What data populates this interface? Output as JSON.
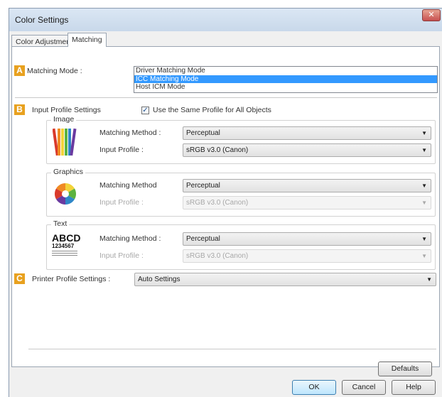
{
  "window": {
    "title": "Color Settings",
    "close_label": "✕"
  },
  "tabs": [
    {
      "label": "Color Adjustment"
    },
    {
      "label": "Matching"
    }
  ],
  "badges": {
    "a": "A",
    "b": "B",
    "c": "C"
  },
  "matching_mode": {
    "label": "Matching Mode :",
    "options": [
      "Driver Matching Mode",
      "ICC Matching Mode",
      "Host ICM Mode"
    ],
    "selected": "ICC Matching Mode"
  },
  "input_profile": {
    "label": "Input Profile Settings",
    "same_profile_label": "Use the Same Profile for All Objects",
    "same_profile_checked": true
  },
  "image_group": {
    "title": "Image",
    "method_label": "Matching Method :",
    "method_value": "Perceptual",
    "profile_label": "Input Profile :",
    "profile_value": "sRGB v3.0 (Canon)"
  },
  "graphics_group": {
    "title": "Graphics",
    "method_label": "Matching Method",
    "method_value": "Perceptual",
    "profile_label": "Input Profile :",
    "profile_value": "sRGB v3.0 (Canon)"
  },
  "text_group": {
    "title": "Text",
    "icon_letters": "ABCD",
    "icon_numbers": "1234567",
    "method_label": "Matching Method :",
    "method_value": "Perceptual",
    "profile_label": "Input Profile :",
    "profile_value": "sRGB v3.0 (Canon)"
  },
  "printer_profile": {
    "label": "Printer Profile Settings :",
    "value": "Auto Settings"
  },
  "buttons": {
    "defaults": "Defaults",
    "ok": "OK",
    "cancel": "Cancel",
    "help": "Help"
  },
  "colors": {
    "badge": "#e8a11f",
    "selection": "#3399ff",
    "close": "#c75050"
  },
  "icons": [
    "close-icon",
    "checkmark-icon",
    "dropdown-arrow-icon",
    "pencils-icon",
    "color-wheel-icon",
    "text-sample-icon"
  ]
}
